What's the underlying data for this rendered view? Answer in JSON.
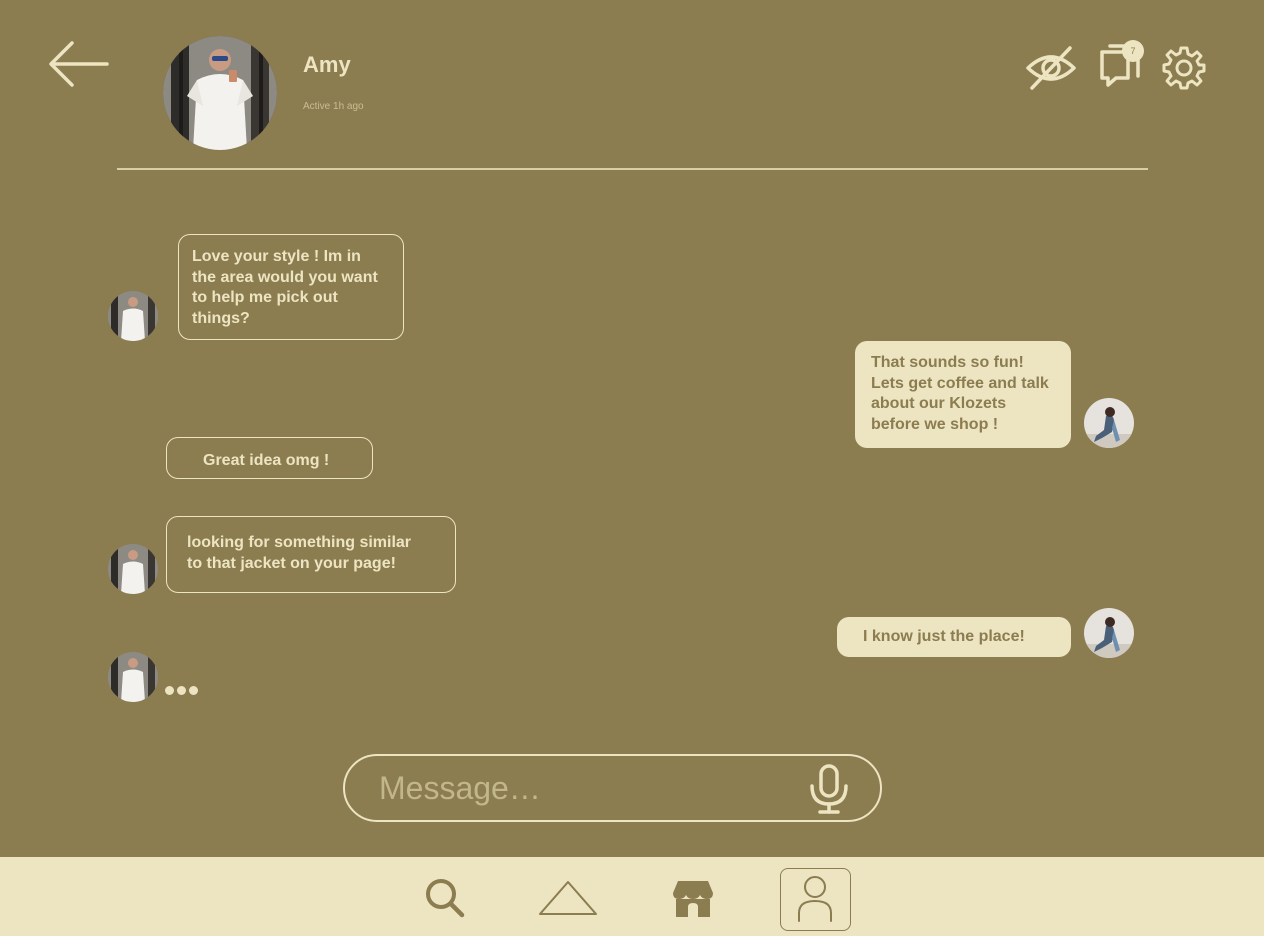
{
  "header": {
    "contact_name": "Amy",
    "contact_status": "Active 1h ago",
    "chats_badge": "7"
  },
  "messages": [
    {
      "sender": "them",
      "text_lines": [
        "Love your style ! Im in",
        "the area would you want",
        "to help me pick out",
        "things?"
      ]
    },
    {
      "sender": "me",
      "text_lines": [
        "That sounds so fun!",
        "Lets get coffee and talk",
        "about our Klozets",
        "before we shop !"
      ]
    },
    {
      "sender": "them",
      "text_lines": [
        "Great idea omg !"
      ]
    },
    {
      "sender": "them",
      "text_lines": [
        "looking for something similar",
        "to that jacket on your page!"
      ]
    },
    {
      "sender": "me",
      "text_lines": [
        "I know just the place!"
      ]
    }
  ],
  "composer": {
    "placeholder": "Message…"
  },
  "icons": {
    "back": "arrow-left-icon",
    "hide": "eye-off-icon",
    "chats": "chat-bubbles-icon",
    "settings": "gear-icon",
    "mic": "microphone-icon",
    "search": "search-icon",
    "home": "triangle-home-icon",
    "store": "storefront-icon",
    "profile": "person-icon"
  },
  "colors": {
    "background": "#8b7d50",
    "cream": "#ede4c2",
    "muted": "#c9bd94"
  }
}
